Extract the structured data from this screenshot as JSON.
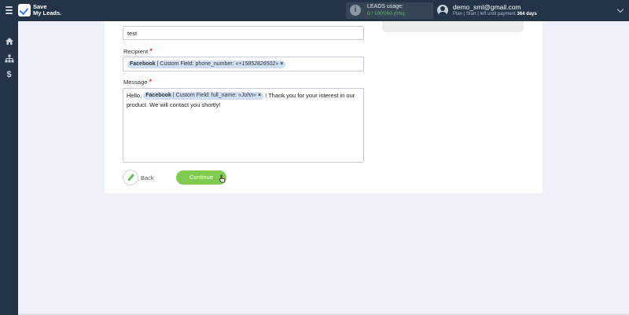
{
  "header": {
    "logo_line1": "Save",
    "logo_line2": "My Leads.",
    "usage_label": "LEADS usage:",
    "usage_value": "0 / 100'000 (0%)",
    "user_email": "demo_sml@gmail.com",
    "plan_prefix": "Plan | Start | left until payment",
    "plan_days": "364 days"
  },
  "form": {
    "first_field_value": "test",
    "recipient_label": "Recipient",
    "recipient_chip": {
      "source": "Facebook",
      "field": " | Custom Field: phone_number: ",
      "value": "«+15852826502»"
    },
    "message_label": "Message",
    "message": {
      "prefix": "Hello, ",
      "chip_source": "Facebook",
      "chip_field": " | Custom Field: full_name: ",
      "chip_value": "«John»",
      "suffix": " ! Thank you for your interest in our product. We will contact you shortly!"
    },
    "required_mark": "*",
    "chip_remove": "×",
    "back_label": "Back",
    "continue_label": "Continue"
  },
  "icons": {
    "menu": "hamburger-icon",
    "home": "home-icon",
    "sitemap": "sitemap-icon",
    "billing": "dollar-icon",
    "info": "info-icon",
    "avatar": "user-icon",
    "dropdown": "chevron-down-icon",
    "back": "pencil-icon"
  },
  "colors": {
    "topbar": "#243447",
    "accent_green": "#7ecb4f",
    "chip_bg": "#cfe0f5",
    "required": "#e03030"
  }
}
